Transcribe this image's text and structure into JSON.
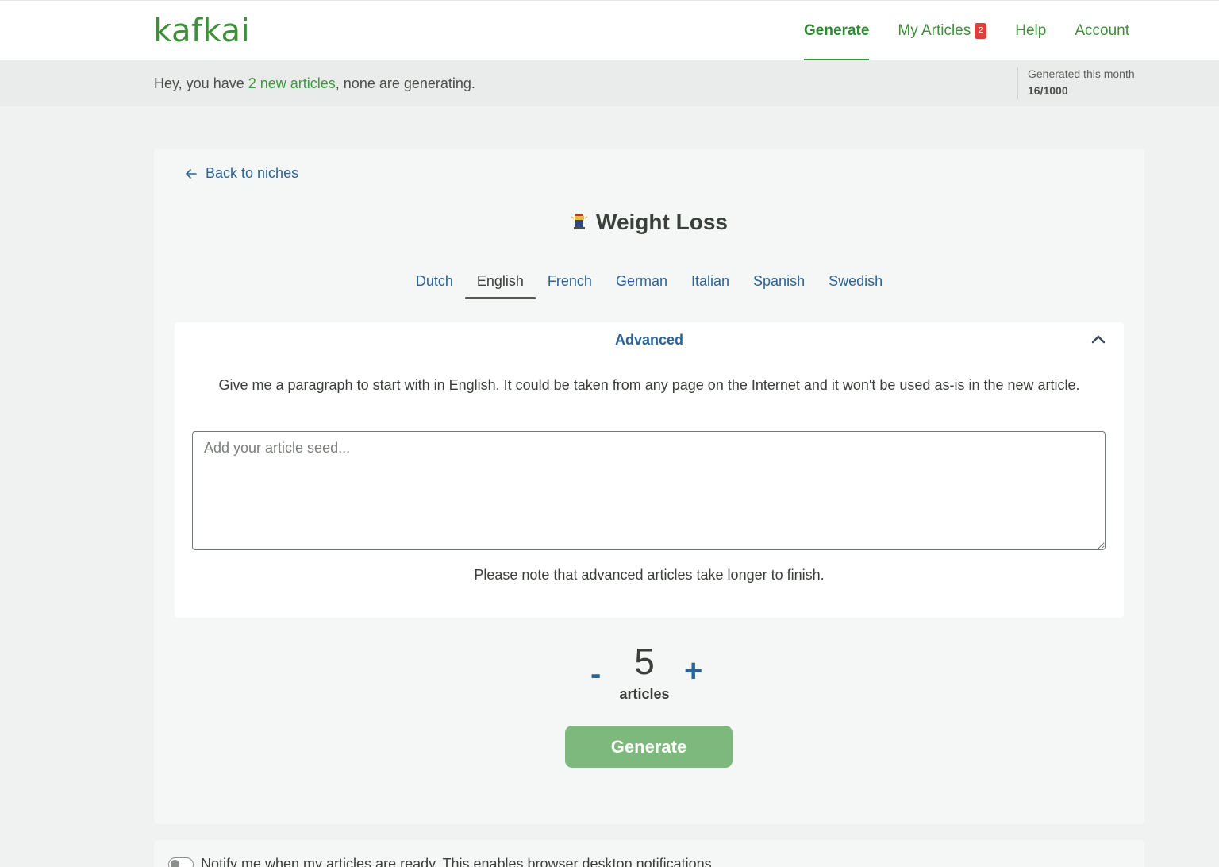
{
  "brand": {
    "logo": "kafkai",
    "color": "#3f8f3a"
  },
  "nav": {
    "items": [
      {
        "label": "Generate",
        "active": true
      },
      {
        "label": "My Articles",
        "badge": "2"
      },
      {
        "label": "Help"
      },
      {
        "label": "Account"
      }
    ]
  },
  "status": {
    "prefix": "Hey, you have ",
    "link": "2 new articles",
    "suffix": ", none are generating.",
    "quota_label": "Generated this month",
    "quota_value": "16/1000"
  },
  "page": {
    "back_label": "Back to niches",
    "niche_icon": "lantern-icon",
    "niche_title": "Weight Loss",
    "languages": [
      "Dutch",
      "English",
      "French",
      "German",
      "Italian",
      "Spanish",
      "Swedish"
    ],
    "active_language": "English"
  },
  "advanced": {
    "title": "Advanced",
    "expanded": true,
    "description": "Give me a paragraph to start with in English. It could be taken from any page on the Internet and it won't be used as-is in the new article.",
    "seed_placeholder": "Add your article seed...",
    "seed_value": "",
    "note": "Please note that advanced articles take longer to finish."
  },
  "counter": {
    "minus": "-",
    "value": "5",
    "label": "articles",
    "plus": "+"
  },
  "generate_label": "Generate",
  "notify": {
    "text": "Notify me when my articles are ready. This enables browser desktop notifications.",
    "enabled": false
  },
  "colors": {
    "accent_green": "#3f9a3d",
    "link_blue": "#2a6496",
    "button_green": "#7db97c",
    "badge_red": "#d9403a"
  }
}
